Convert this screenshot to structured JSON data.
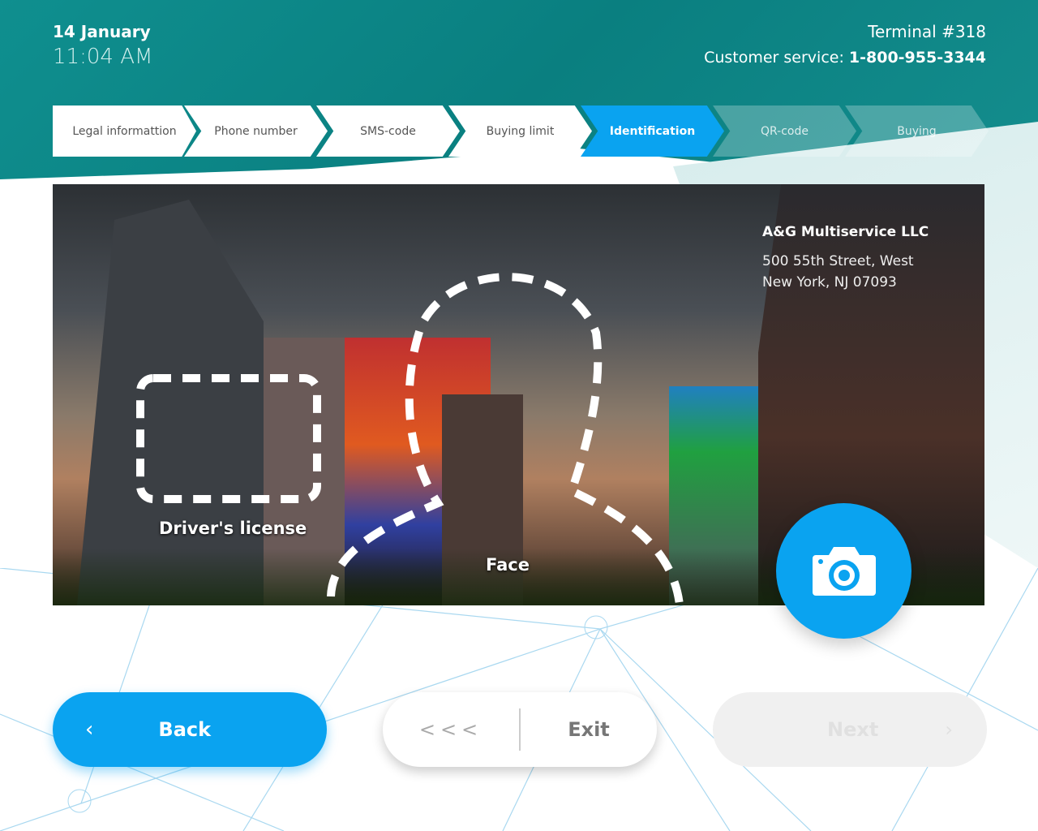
{
  "header": {
    "date": "14 January",
    "time": "11:04 AM",
    "terminal": "Terminal #318",
    "customer_service_label": "Customer service: ",
    "customer_service_phone": "1-800-955-3344"
  },
  "steps": [
    {
      "label": "Legal informattion",
      "state": "done"
    },
    {
      "label": "Phone number",
      "state": "done"
    },
    {
      "label": "SMS-code",
      "state": "done"
    },
    {
      "label": "Buying limit",
      "state": "done"
    },
    {
      "label": "Identification",
      "state": "active"
    },
    {
      "label": "QR-code",
      "state": "future"
    },
    {
      "label": "Buying",
      "state": "future"
    }
  ],
  "camera_view": {
    "company": "A&G Multiservice LLC",
    "address_line1": "500 55th Street, West",
    "address_line2": "New York, NJ 07093",
    "license_label": "Driver's license",
    "face_label": "Face"
  },
  "buttons": {
    "back": "Back",
    "exit_arrows": "<<<",
    "exit": "Exit",
    "next": "Next"
  },
  "colors": {
    "accent": "#0aa3f0",
    "header_teal": "#0a7f80"
  }
}
